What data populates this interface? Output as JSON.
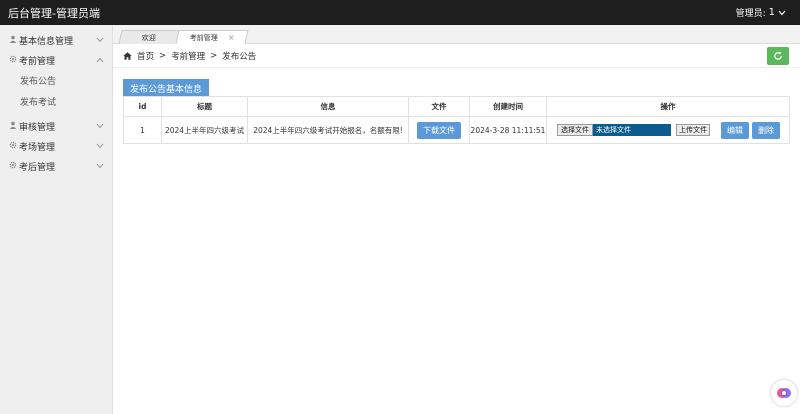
{
  "header": {
    "title": "后台管理-管理员端",
    "user_label": "管理员:",
    "user_name": "1"
  },
  "sidebar": {
    "items": [
      {
        "label": "基本信息管理"
      },
      {
        "label": "考前管理",
        "children": [
          "发布公告",
          "发布考试"
        ]
      },
      {
        "label": "审核管理"
      },
      {
        "label": "考场管理"
      },
      {
        "label": "考后管理"
      }
    ]
  },
  "tabs": [
    {
      "label": "欢迎"
    },
    {
      "label": "考前管理",
      "close": "×"
    }
  ],
  "breadcrumb": {
    "home": "首页",
    "sep": ">",
    "section": "考前管理",
    "page": "发布公告"
  },
  "panel": {
    "title": "发布公告基本信息"
  },
  "table": {
    "headers": [
      "id",
      "标题",
      "信息",
      "文件",
      "创建时间",
      "操作"
    ],
    "rows": [
      {
        "id": "1",
        "title": "2024上半年四六级考试",
        "info": "2024上半年四六级考试开始报名，名额有限!",
        "download_label": "下载文件",
        "created": "2024-3-28 11:11:51",
        "choose_file": "选择文件",
        "file_status": "未选择文件",
        "upload_label": "上传文件",
        "edit_label": "编辑",
        "delete_label": "删除"
      }
    ]
  },
  "colors": {
    "topbar": "#1e1e1e",
    "primary_button": "#5b9ad6",
    "refresh_button": "#5cb85c",
    "file_status_bg": "#0b5c8e"
  }
}
